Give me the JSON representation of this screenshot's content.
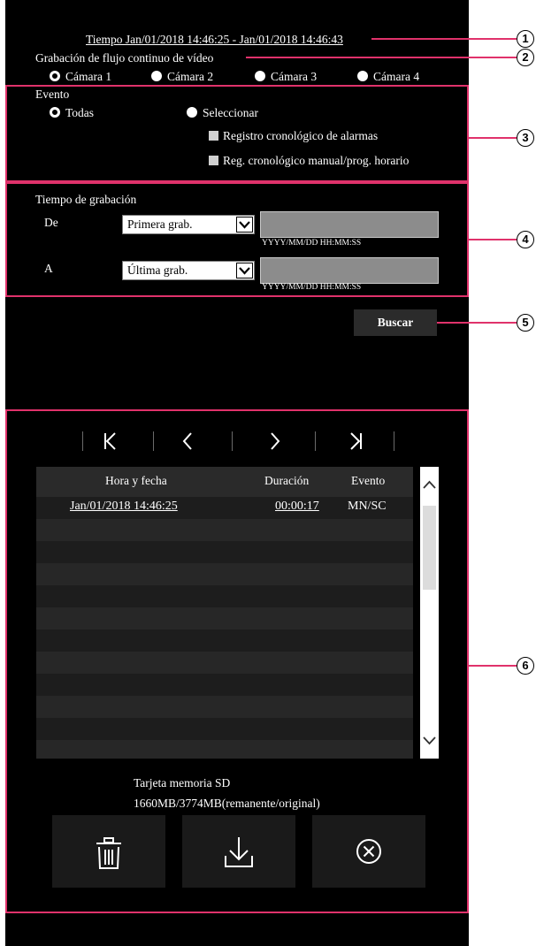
{
  "header": {
    "time_range": "Tiempo Jan/01/2018 14:46:25 - Jan/01/2018 14:46:43",
    "stream_title": "Grabación de flujo continuo de vídeo"
  },
  "cameras": [
    {
      "label": "Cámara 1",
      "selected": true
    },
    {
      "label": "Cámara 2",
      "selected": false
    },
    {
      "label": "Cámara 3",
      "selected": false
    },
    {
      "label": "Cámara 4",
      "selected": false
    }
  ],
  "event": {
    "title": "Evento",
    "all_label": "Todas",
    "select_label": "Seleccionar",
    "alarm_log_label": "Registro cronológico de alarmas",
    "manual_log_label": "Reg. cronológico manual/prog. horario"
  },
  "recording_time": {
    "title": "Tiempo de grabación",
    "from_label": "De",
    "from_select": "Primera grab.",
    "from_value": "",
    "to_label": "A",
    "to_select": "Última grab.",
    "to_value": "",
    "format_hint": "YYYY/MM/DD HH:MM:SS"
  },
  "search_button": "Buscar",
  "navigation": {
    "first": "K",
    "prev": "<",
    "next": ">",
    "last": ">|"
  },
  "table": {
    "columns": [
      "Hora y fecha",
      "Duración",
      "Evento"
    ],
    "rows": [
      {
        "datetime": "Jan/01/2018  14:46:25",
        "duration": "00:00:17",
        "event": "MN/SC"
      }
    ]
  },
  "sd_card": {
    "title": "Tarjeta memoria SD",
    "capacity": "1660MB/3774MB(remanente/original)"
  },
  "callouts": [
    "1",
    "2",
    "3",
    "4",
    "5",
    "6"
  ],
  "colors": {
    "background": "#000000",
    "highlight": "#e0326b",
    "field": "#8c8c8c"
  }
}
